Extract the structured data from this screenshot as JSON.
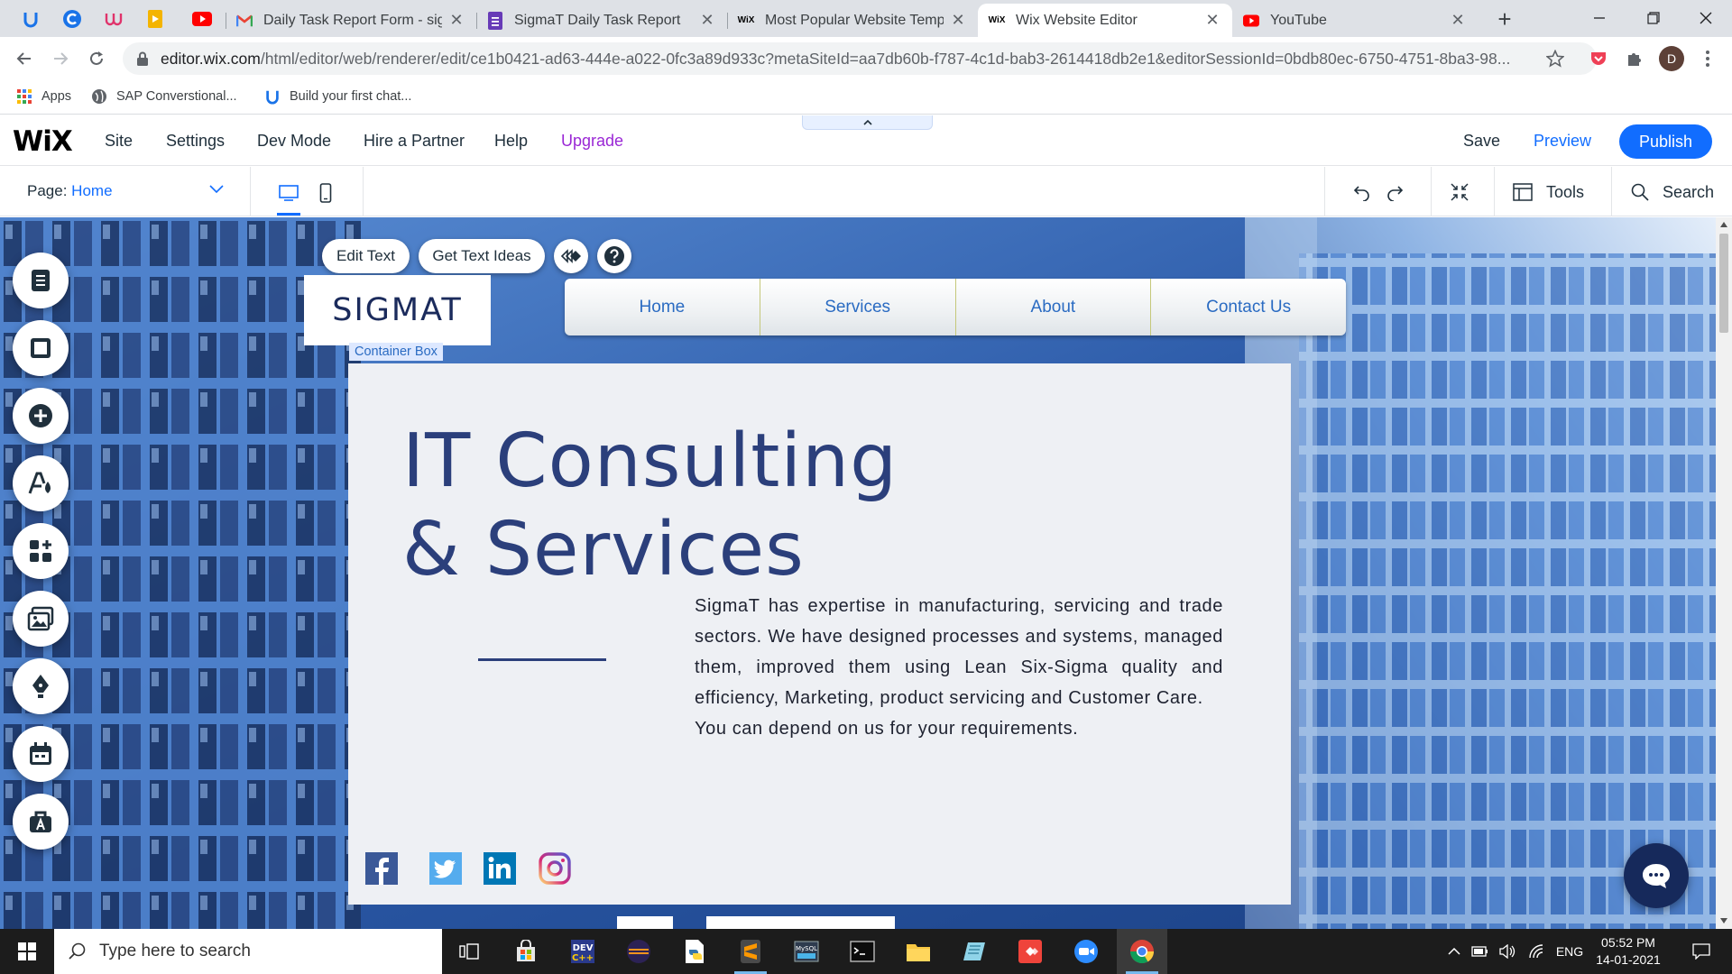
{
  "browser": {
    "tabs": [
      {
        "title": "Daily Task Report Form - sigma",
        "icon": "gmail-icon"
      },
      {
        "title": "SigmaT Daily Task Report",
        "icon": "forms-icon"
      },
      {
        "title": "Most Popular Website Templates",
        "icon": "wix-icon"
      },
      {
        "title": "Wix Website Editor",
        "icon": "wix-icon",
        "active": true
      },
      {
        "title": "YouTube",
        "icon": "youtube-icon"
      }
    ],
    "url_host": "editor.wix.com",
    "url_path": "/html/editor/web/renderer/edit/ce1b0421-ad63-444e-a022-0fc3a89d933c?metaSiteId=aa7db60b-f787-4c1d-bab3-2614418db2e1&editorSessionId=0bdb80ec-6750-4751-8ba3-98...",
    "profile_initial": "D",
    "bookmarks": [
      {
        "label": "Apps",
        "icon": "apps-grid-icon"
      },
      {
        "label": "SAP Converstional...",
        "icon": "globe-icon"
      },
      {
        "label": "Build your first chat...",
        "icon": "u-logo-icon"
      }
    ]
  },
  "wix": {
    "logo": "WiX",
    "menu": [
      "Site",
      "Settings",
      "Dev Mode",
      "Hire a Partner",
      "Help"
    ],
    "upgrade": "Upgrade",
    "save": "Save",
    "preview": "Preview",
    "publish": "Publish",
    "page_label": "Page:",
    "page_value": "Home",
    "tools": "Tools",
    "search": "Search"
  },
  "text_toolbar": {
    "edit_text": "Edit Text",
    "text_ideas": "Get Text Ideas"
  },
  "site": {
    "logo": "SIGMAT",
    "nav": [
      "Home",
      "Services",
      "About",
      "Contact Us"
    ],
    "container_label": "Container Box",
    "title_line1": "IT Consulting",
    "title_line2": "& Services",
    "body_p1": "SigmaT has expertise in manufacturing, servicing and trade sectors. We have designed processes and systems, managed them, improved them using Lean Six-Sigma quality and efficiency, Marketing, product servicing and Customer Care.",
    "body_p2": "You can depend on us for your requirements.",
    "social": [
      "facebook-icon",
      "twitter-icon",
      "linkedin-icon",
      "instagram-icon"
    ]
  },
  "taskbar": {
    "search_placeholder": "Type here to search",
    "language": "ENG",
    "time": "05:52 PM",
    "date": "14-01-2021"
  },
  "colors": {
    "wix_blue": "#116dff",
    "upgrade_purple": "#9a27d5",
    "hero_navy": "#2b3f7b",
    "nav_link": "#2a6bc2"
  }
}
